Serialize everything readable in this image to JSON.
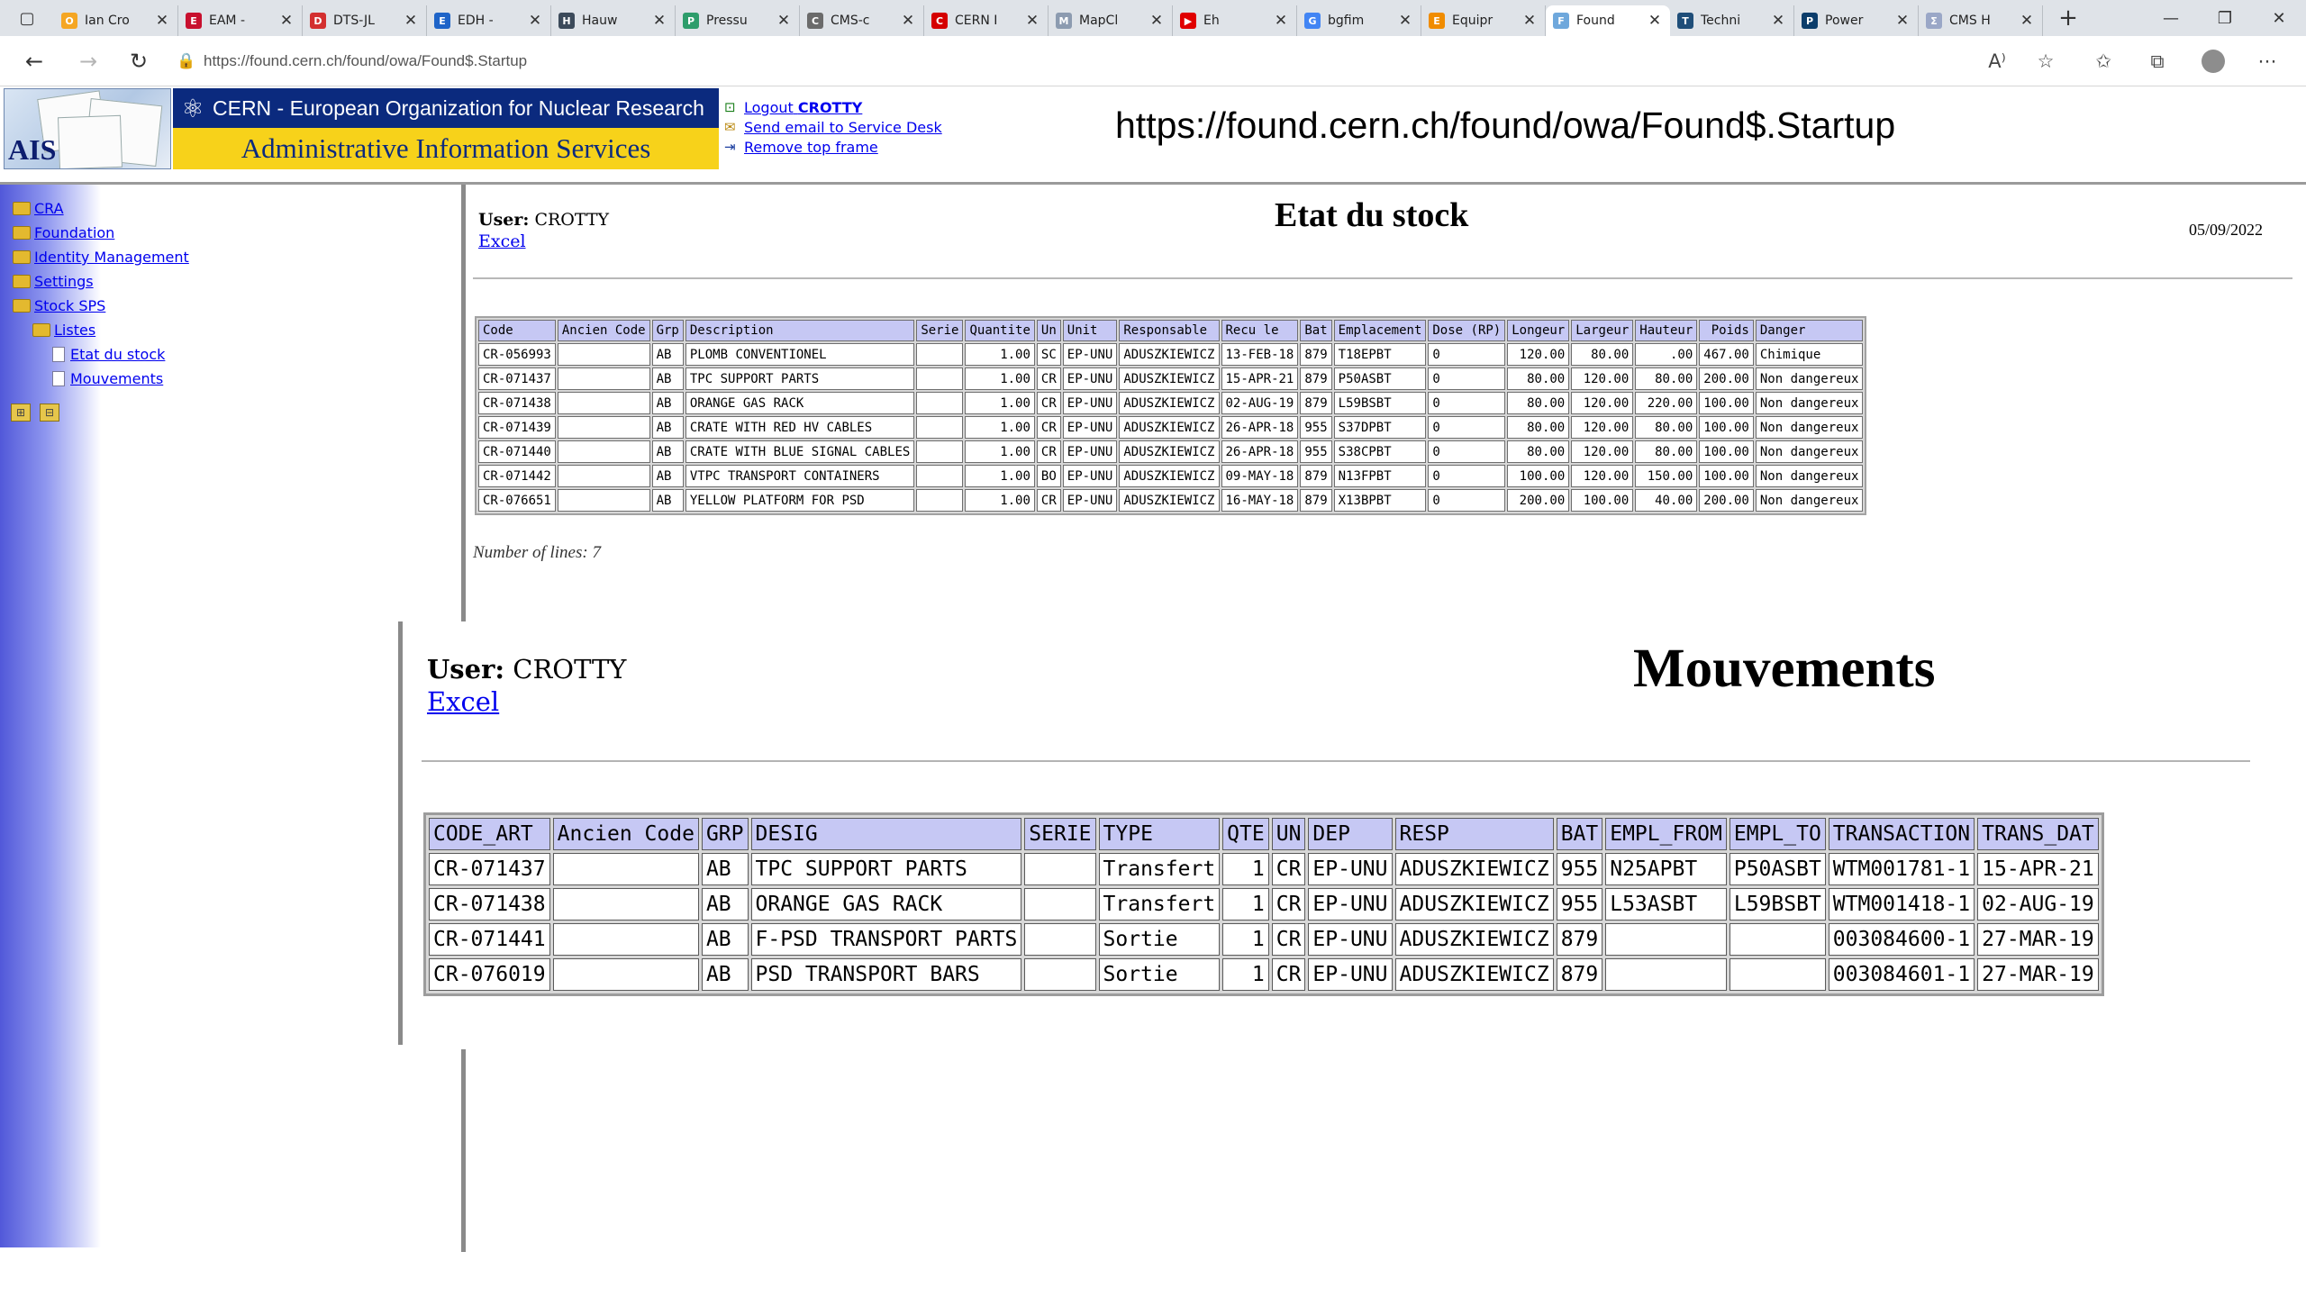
{
  "browser": {
    "tabs": [
      {
        "title": "Ian Cro",
        "icon": "orange-o-icon",
        "color": "#f5a623",
        "glyph": "O"
      },
      {
        "title": "EAM -",
        "icon": "eam-icon",
        "color": "#c8102e",
        "glyph": "E"
      },
      {
        "title": "DTS-JL",
        "icon": "document-icon",
        "color": "#d32f2f",
        "glyph": "D"
      },
      {
        "title": "EDH -",
        "icon": "edh-icon",
        "color": "#1e64c8",
        "glyph": "E"
      },
      {
        "title": "Hauw",
        "icon": "circle-icon",
        "color": "#3c4a5a",
        "glyph": "H"
      },
      {
        "title": "Pressu",
        "icon": "pressure-icon",
        "color": "#2e9d6b",
        "glyph": "P"
      },
      {
        "title": "CMS-c",
        "icon": "page-icon",
        "color": "#6b6b6b",
        "glyph": "C"
      },
      {
        "title": "CERN I",
        "icon": "cern-red-icon",
        "color": "#d50000",
        "glyph": "C"
      },
      {
        "title": "MapCl",
        "icon": "map-icon",
        "color": "#8c9bb0",
        "glyph": "M"
      },
      {
        "title": "Eh",
        "icon": "youtube-icon",
        "color": "#e00000",
        "glyph": "▶"
      },
      {
        "title": "bgfim",
        "icon": "google-icon",
        "color": "#4285f4",
        "glyph": "G"
      },
      {
        "title": "Equipr",
        "icon": "equipment-icon",
        "color": "#f08c00",
        "glyph": "E"
      },
      {
        "title": "Found",
        "icon": "loading-icon",
        "color": "#6fa8dc",
        "glyph": "F"
      },
      {
        "title": "Techni",
        "icon": "techni-icon",
        "color": "#1f4e79",
        "glyph": "T"
      },
      {
        "title": "Power",
        "icon": "power-icon",
        "color": "#0b3d6b",
        "glyph": "P"
      },
      {
        "title": "CMS H",
        "icon": "sigma-icon",
        "color": "#9aa7c7",
        "glyph": "Σ"
      }
    ],
    "active_tab": 12,
    "address": "https://found.cern.ch/found/owa/Found$.Startup"
  },
  "header": {
    "logo_text": "AIS",
    "org": "CERN - European Organization for Nuclear Research",
    "service": "Administrative Information Services",
    "logout_label": "Logout",
    "logout_user": "CROTTY",
    "email_link": "Send email to Service Desk",
    "remove_frame_link": "Remove top frame",
    "url_caption": "https://found.cern.ch/found/owa/Found$.Startup"
  },
  "nav": {
    "items": [
      {
        "label": "CRA",
        "level": 0,
        "kind": "folder"
      },
      {
        "label": "Foundation",
        "level": 0,
        "kind": "folder"
      },
      {
        "label": "Identity Management",
        "level": 0,
        "kind": "folder"
      },
      {
        "label": "Settings",
        "level": 0,
        "kind": "folder"
      },
      {
        "label": "Stock SPS",
        "level": 0,
        "kind": "folder"
      },
      {
        "label": "Listes",
        "level": 1,
        "kind": "folder"
      },
      {
        "label": "Etat du stock",
        "level": 2,
        "kind": "doc"
      },
      {
        "label": "Mouvements",
        "level": 2,
        "kind": "doc"
      }
    ]
  },
  "stock": {
    "user_label": "User:",
    "user": "CROTTY",
    "excel": "Excel",
    "title": "Etat du stock",
    "date": "05/09/2022",
    "columns": [
      "Code",
      "Ancien Code",
      "Grp",
      "Description",
      "Serie",
      "Quantite",
      "Un",
      "Unit",
      "Responsable",
      "Recu le",
      "Bat",
      "Emplacement",
      "Dose (RP)",
      "Longeur",
      "Largeur",
      "Hauteur",
      "Poids",
      "Danger"
    ],
    "rows": [
      [
        "CR-056993",
        "",
        "AB",
        "PLOMB CONVENTIONEL",
        "",
        "1.00",
        "SC",
        "EP-UNU",
        "ADUSZKIEWICZ",
        "13-FEB-18",
        "879",
        "T18EPBT",
        "0",
        "120.00",
        "80.00",
        ".00",
        "467.00",
        "Chimique"
      ],
      [
        "CR-071437",
        "",
        "AB",
        "TPC SUPPORT PARTS",
        "",
        "1.00",
        "CR",
        "EP-UNU",
        "ADUSZKIEWICZ",
        "15-APR-21",
        "879",
        "P50ASBT",
        "0",
        "80.00",
        "120.00",
        "80.00",
        "200.00",
        "Non dangereux"
      ],
      [
        "CR-071438",
        "",
        "AB",
        "ORANGE GAS RACK",
        "",
        "1.00",
        "CR",
        "EP-UNU",
        "ADUSZKIEWICZ",
        "02-AUG-19",
        "879",
        "L59BSBT",
        "0",
        "80.00",
        "120.00",
        "220.00",
        "100.00",
        "Non dangereux"
      ],
      [
        "CR-071439",
        "",
        "AB",
        "CRATE WITH RED HV CABLES",
        "",
        "1.00",
        "CR",
        "EP-UNU",
        "ADUSZKIEWICZ",
        "26-APR-18",
        "955",
        "S37DPBT",
        "0",
        "80.00",
        "120.00",
        "80.00",
        "100.00",
        "Non dangereux"
      ],
      [
        "CR-071440",
        "",
        "AB",
        "CRATE WITH BLUE SIGNAL CABLES",
        "",
        "1.00",
        "CR",
        "EP-UNU",
        "ADUSZKIEWICZ",
        "26-APR-18",
        "955",
        "S38CPBT",
        "0",
        "80.00",
        "120.00",
        "80.00",
        "100.00",
        "Non dangereux"
      ],
      [
        "CR-071442",
        "",
        "AB",
        "VTPC TRANSPORT CONTAINERS",
        "",
        "1.00",
        "BO",
        "EP-UNU",
        "ADUSZKIEWICZ",
        "09-MAY-18",
        "879",
        "N13FPBT",
        "0",
        "100.00",
        "120.00",
        "150.00",
        "100.00",
        "Non dangereux"
      ],
      [
        "CR-076651",
        "",
        "AB",
        "YELLOW PLATFORM FOR PSD",
        "",
        "1.00",
        "CR",
        "EP-UNU",
        "ADUSZKIEWICZ",
        "16-MAY-18",
        "879",
        "X13BPBT",
        "0",
        "200.00",
        "100.00",
        "40.00",
        "200.00",
        "Non dangereux"
      ]
    ],
    "lines_label": "Number of lines: 7"
  },
  "mouvements": {
    "user_label": "User:",
    "user": "CROTTY",
    "excel": "Excel",
    "title": "Mouvements",
    "columns": [
      "CODE_ART",
      "Ancien Code",
      "GRP",
      "DESIG",
      "SERIE",
      "TYPE",
      "QTE",
      "UN",
      "DEP",
      "RESP",
      "BAT",
      "EMPL_FROM",
      "EMPL_TO",
      "TRANSACTION",
      "TRANS_DAT"
    ],
    "rows": [
      [
        "CR-071437",
        "",
        "AB",
        "TPC SUPPORT PARTS",
        "",
        "Transfert",
        "1",
        "CR",
        "EP-UNU",
        "ADUSZKIEWICZ",
        "955",
        "N25APBT",
        "P50ASBT",
        "WTM001781-1",
        "15-APR-21"
      ],
      [
        "CR-071438",
        "",
        "AB",
        "ORANGE GAS RACK",
        "",
        "Transfert",
        "1",
        "CR",
        "EP-UNU",
        "ADUSZKIEWICZ",
        "955",
        "L53ASBT",
        "L59BSBT",
        "WTM001418-1",
        "02-AUG-19"
      ],
      [
        "CR-071441",
        "",
        "AB",
        "F-PSD TRANSPORT PARTS",
        "",
        "Sortie",
        "1",
        "CR",
        "EP-UNU",
        "ADUSZKIEWICZ",
        "879",
        "",
        "",
        "003084600-1",
        "27-MAR-19"
      ],
      [
        "CR-076019",
        "",
        "AB",
        "PSD TRANSPORT BARS",
        "",
        "Sortie",
        "1",
        "CR",
        "EP-UNU",
        "ADUSZKIEWICZ",
        "879",
        "",
        "",
        "003084601-1",
        "27-MAR-19"
      ]
    ]
  }
}
